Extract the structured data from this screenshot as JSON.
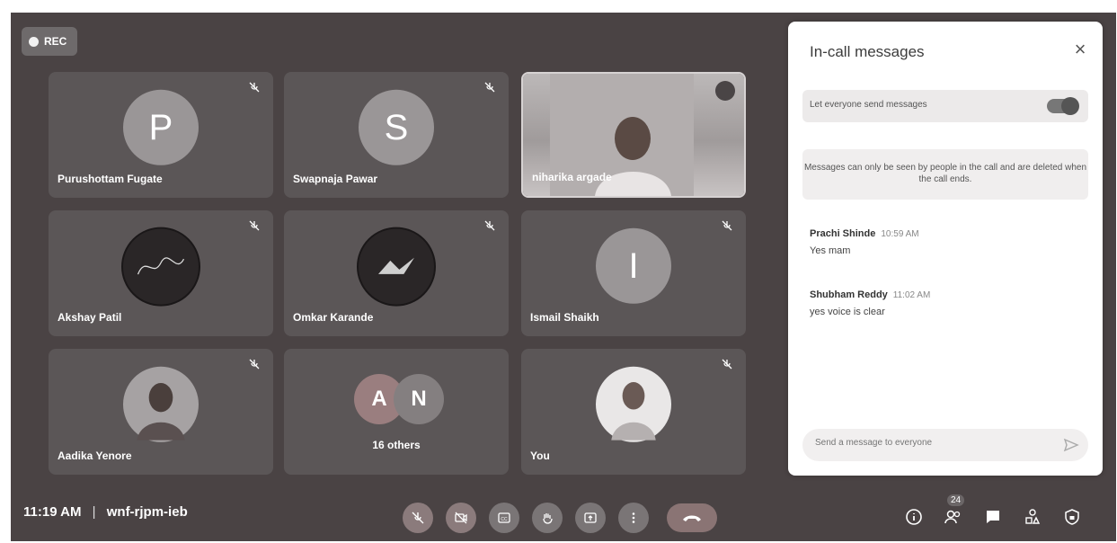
{
  "recording": {
    "label": "REC"
  },
  "participants": [
    {
      "name": "Purushottam Fugate",
      "initial": "P"
    },
    {
      "name": "Swapnaja Pawar",
      "initial": "S"
    },
    {
      "name": "niharika argade"
    },
    {
      "name": "Akshay Patil"
    },
    {
      "name": "Omkar Karande"
    },
    {
      "name": "Ismail Shaikh",
      "initial": "I"
    },
    {
      "name": "Aadika Yenore"
    },
    {
      "name": "16 others",
      "initials": [
        "A",
        "N"
      ]
    },
    {
      "name": "You"
    }
  ],
  "bottom_bar": {
    "time": "11:19 AM",
    "separator": "|",
    "meeting_code": "wnf-rjpm-ieb",
    "people_count": "24"
  },
  "chat_panel": {
    "title": "In-call messages",
    "toggle_label": "Let everyone send messages",
    "toggle_on": true,
    "notice": "Messages can only be seen by people in the call and are deleted when the call ends.",
    "messages": [
      {
        "sender": "Prachi Shinde",
        "time": "10:59 AM",
        "text": "Yes mam"
      },
      {
        "sender": "Shubham Reddy",
        "time": "11:02 AM",
        "text": "yes voice is clear"
      }
    ],
    "input_placeholder": "Send a message to everyone"
  },
  "colors": {
    "background": "#4a4344",
    "tile": "#5b5657",
    "panel": "#ffffff"
  }
}
